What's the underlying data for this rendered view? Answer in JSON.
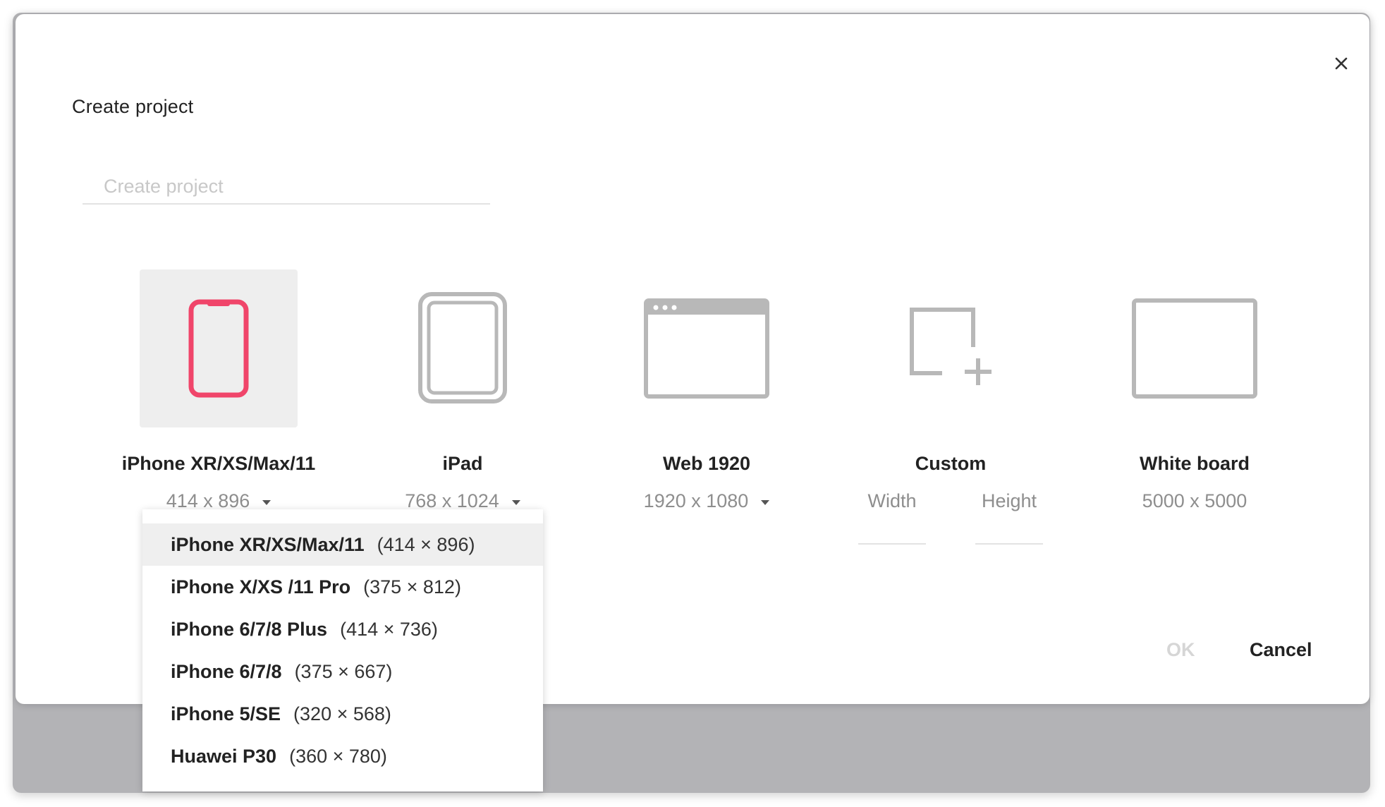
{
  "dialog": {
    "title": "Create project",
    "name_placeholder": "Create project",
    "ok_label": "OK",
    "cancel_label": "Cancel"
  },
  "devices": [
    {
      "name": "iPhone XR/XS/Max/11",
      "size": "414 x 896",
      "icon": "phone-icon",
      "selected": true
    },
    {
      "name": "iPad",
      "size": "768 x 1024",
      "icon": "tablet-icon"
    },
    {
      "name": "Web 1920",
      "size": "1920 x 1080",
      "icon": "browser-window-icon"
    },
    {
      "name": "Custom",
      "width_label": "Width",
      "height_label": "Height",
      "icon": "custom-frame-icon"
    },
    {
      "name": "White board",
      "size": "5000 x 5000",
      "icon": "whiteboard-icon"
    }
  ],
  "dropdown": {
    "items": [
      {
        "name": "iPhone XR/XS/Max/11",
        "size": "(414 × 896)",
        "active": true
      },
      {
        "name": "iPhone X/XS /11 Pro",
        "size": "(375 × 812)"
      },
      {
        "name": "iPhone 6/7/8 Plus",
        "size": "(414 × 736)"
      },
      {
        "name": "iPhone 6/7/8",
        "size": "(375 × 667)"
      },
      {
        "name": "iPhone 5/SE",
        "size": "(320 × 568)"
      },
      {
        "name": "Huawei P30",
        "size": "(360 × 780)"
      }
    ]
  },
  "colors": {
    "accent": "#f0456a",
    "icon_gray": "#b8b8b8",
    "tile_selected": "#eeeeee"
  }
}
